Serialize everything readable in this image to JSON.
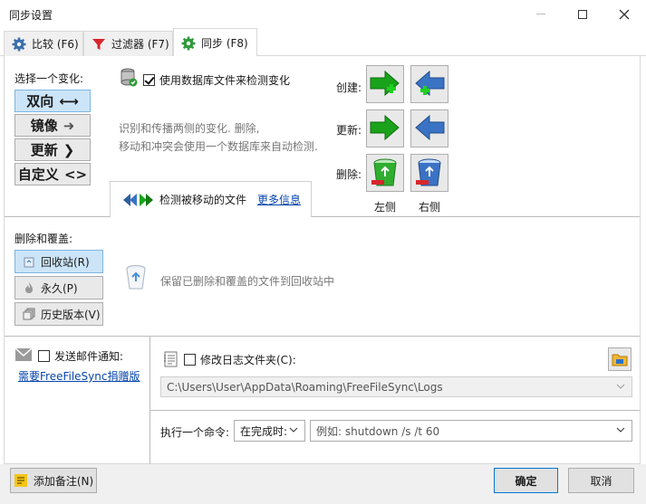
{
  "window": {
    "title": "同步设置"
  },
  "tabs": [
    {
      "label": "比较 (F6)"
    },
    {
      "label": "过滤器 (F7)"
    },
    {
      "label": "同步 (F8)"
    }
  ],
  "variant": {
    "section_label": "选择一个变化:",
    "buttons": [
      {
        "label": "双向",
        "symbol": "⟷",
        "selected": true
      },
      {
        "label": "镜像",
        "symbol": "➜",
        "selected": false
      },
      {
        "label": "更新",
        "symbol": "❯",
        "selected": false
      },
      {
        "label": "自定义",
        "symbol": "<>",
        "selected": false
      }
    ]
  },
  "database": {
    "checkbox_label": "使用数据库文件来检测变化",
    "checked": true,
    "description_line1": "识别和传播两侧的变化. 删除,",
    "description_line2": "移动和冲突会使用一个数据库来自动检测.",
    "detect_moved_label": "检测被移动的文件",
    "more_info_link": "更多信息"
  },
  "directions": {
    "create_label": "创建:",
    "update_label": "更新:",
    "delete_label": "删除:",
    "left_label": "左侧",
    "right_label": "右侧"
  },
  "deletion": {
    "section_label": "删除和覆盖:",
    "options": [
      {
        "label": "回收站(R)",
        "selected": true
      },
      {
        "label": "永久(P)",
        "selected": false
      },
      {
        "label": "历史版本(V)",
        "selected": false
      }
    ],
    "description": "保留已删除和覆盖的文件到回收站中"
  },
  "email": {
    "checkbox_label": "发送邮件通知:",
    "checked": false,
    "donation_link": "需要FreeFileSync捐赠版"
  },
  "log": {
    "checkbox_label": "修改日志文件夹(C):",
    "checked": false,
    "path": "C:\\Users\\User\\AppData\\Roaming\\FreeFileSync\\Logs"
  },
  "command": {
    "label": "执行一个命令:",
    "trigger_value": "在完成时:",
    "placeholder": "例如: shutdown /s /t 60"
  },
  "footer": {
    "add_note_label": "添加备注(N)",
    "ok_label": "确定",
    "cancel_label": "取消"
  },
  "colors": {
    "selected_bg": "#cce4f7",
    "link": "#0645ad",
    "arrow_green": "#1aa31a",
    "arrow_blue": "#3b73c4"
  }
}
